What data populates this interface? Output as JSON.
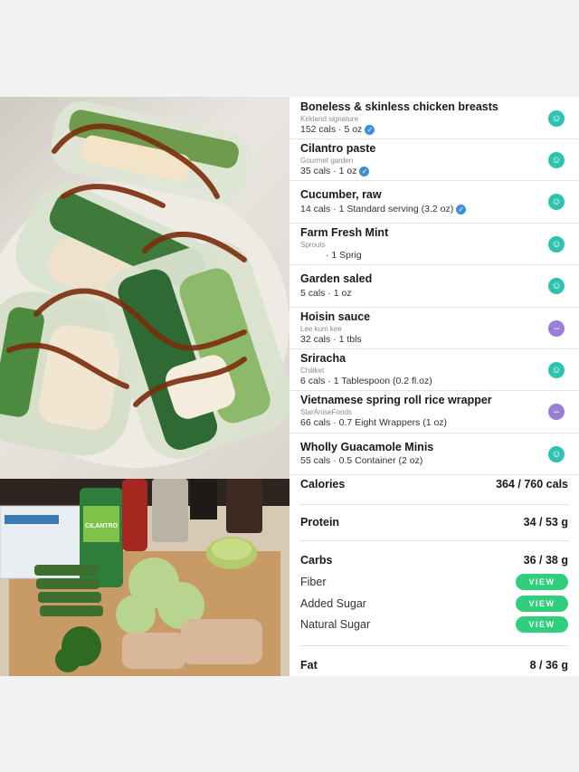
{
  "foods": [
    {
      "name": "Boneless & skinless chicken breasts",
      "brand": "Kirkland signature",
      "detail": "152 cals · 5 oz",
      "verified": true,
      "face": "good"
    },
    {
      "name": "Cilantro paste",
      "brand": "Gourmet garden",
      "detail": "35 cals · 1 oz",
      "verified": true,
      "face": "good"
    },
    {
      "name": "Cucumber, raw",
      "brand": "",
      "detail": "14 cals · 1 Standard serving (3.2 oz)",
      "verified": true,
      "face": "good"
    },
    {
      "name": "Farm Fresh Mint",
      "brand": "Sprouts",
      "detail": "· 1 Sprig",
      "verified": false,
      "face": "good"
    },
    {
      "name": "Garden saled",
      "brand": "",
      "detail": "5 cals · 1 oz",
      "verified": false,
      "face": "good"
    },
    {
      "name": "Hoisin sauce",
      "brand": "Lee kum kee",
      "detail": "32 cals · 1 tbls",
      "verified": false,
      "face": "neutral"
    },
    {
      "name": "Sriracha",
      "brand": "Chiliket",
      "detail": "6 cals · 1 Tablespoon (0.2 fl.oz)",
      "verified": false,
      "face": "good"
    },
    {
      "name": "Vietnamese spring roll rice wrapper",
      "brand": "StarAniseFoods",
      "detail": "66 cals · 0.7 Eight Wrappers (1 oz)",
      "verified": false,
      "face": "neutral"
    },
    {
      "name": "Wholly Guacamole Minis",
      "brand": "",
      "detail": "55 cals · 0.5 Container (2 oz)",
      "verified": false,
      "face": "good"
    }
  ],
  "nutrition": {
    "calories": {
      "label": "Calories",
      "value": "364 / 760 cals"
    },
    "protein": {
      "label": "Protein",
      "value": "34 / 53 g"
    },
    "carbs": {
      "label": "Carbs",
      "value": "36 / 38 g"
    },
    "fiber": {
      "label": "Fiber",
      "button": "VIEW"
    },
    "added_sugar": {
      "label": "Added Sugar",
      "button": "VIEW"
    },
    "natural_sugar": {
      "label": "Natural Sugar",
      "button": "VIEW"
    },
    "fat": {
      "label": "Fat",
      "value": "8 / 36 g"
    }
  },
  "colors": {
    "accent_green": "#2fcf7d",
    "face_good": "#2ec3b0",
    "face_neutral": "#9a7fd6",
    "verified_blue": "#3b8ed8"
  },
  "icons": {
    "verified": "verified-check-icon",
    "good": "smile-face-icon",
    "neutral": "neutral-face-icon"
  },
  "labels": {
    "cilantro_tube": "CILANTRO"
  }
}
